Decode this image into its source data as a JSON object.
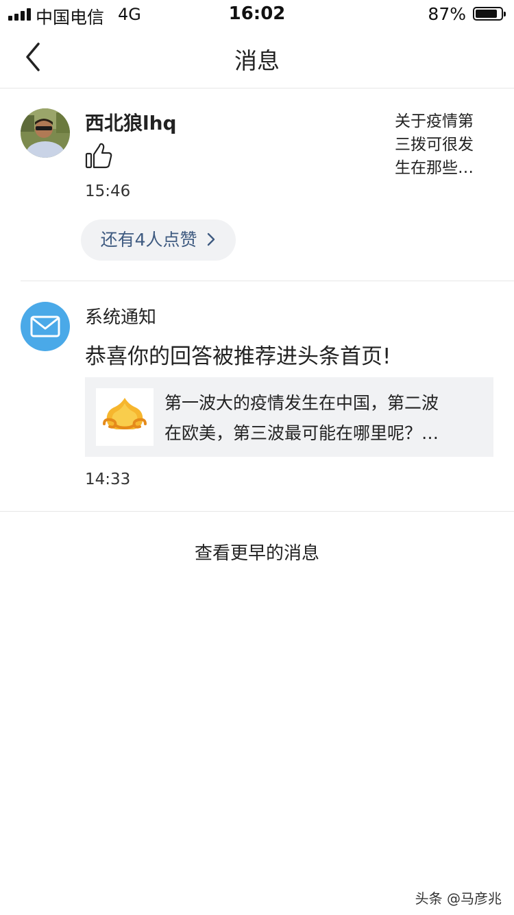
{
  "status_bar": {
    "carrier": "中国电信",
    "network": "4G",
    "time": "16:02",
    "battery_percent": "87%",
    "battery_level": 0.87
  },
  "navbar": {
    "back_icon": "chevron-left-icon",
    "title": "消息"
  },
  "like_notification": {
    "user_name": "西北狼lhq",
    "action_icon": "thumbs-up-icon",
    "time": "15:46",
    "preview_lines": [
      "关于疫情第",
      "三拨可很发",
      "生在那些…"
    ],
    "more_likes_label": "还有4人点赞",
    "more_likes_icon": "chevron-right-icon"
  },
  "system_notification": {
    "icon": "mail-icon",
    "icon_color": "#4aa9e8",
    "title": "系统通知",
    "message": "恭喜你的回答被推荐进头条首页!",
    "article": {
      "thumb_icon": "toutiao-logo",
      "lines": [
        "第一波大的疫情发生在中国，第二波",
        "在欧美，第三波最可能在哪里呢？…"
      ]
    },
    "time": "14:33"
  },
  "earlier_label": "查看更早的消息",
  "watermark": "头条 @马彦兆",
  "colors": {
    "accent_blue": "#3e5a80",
    "pill_bg": "#f1f2f4",
    "card_bg": "#f1f2f4",
    "divider": "#e6e6e6"
  }
}
